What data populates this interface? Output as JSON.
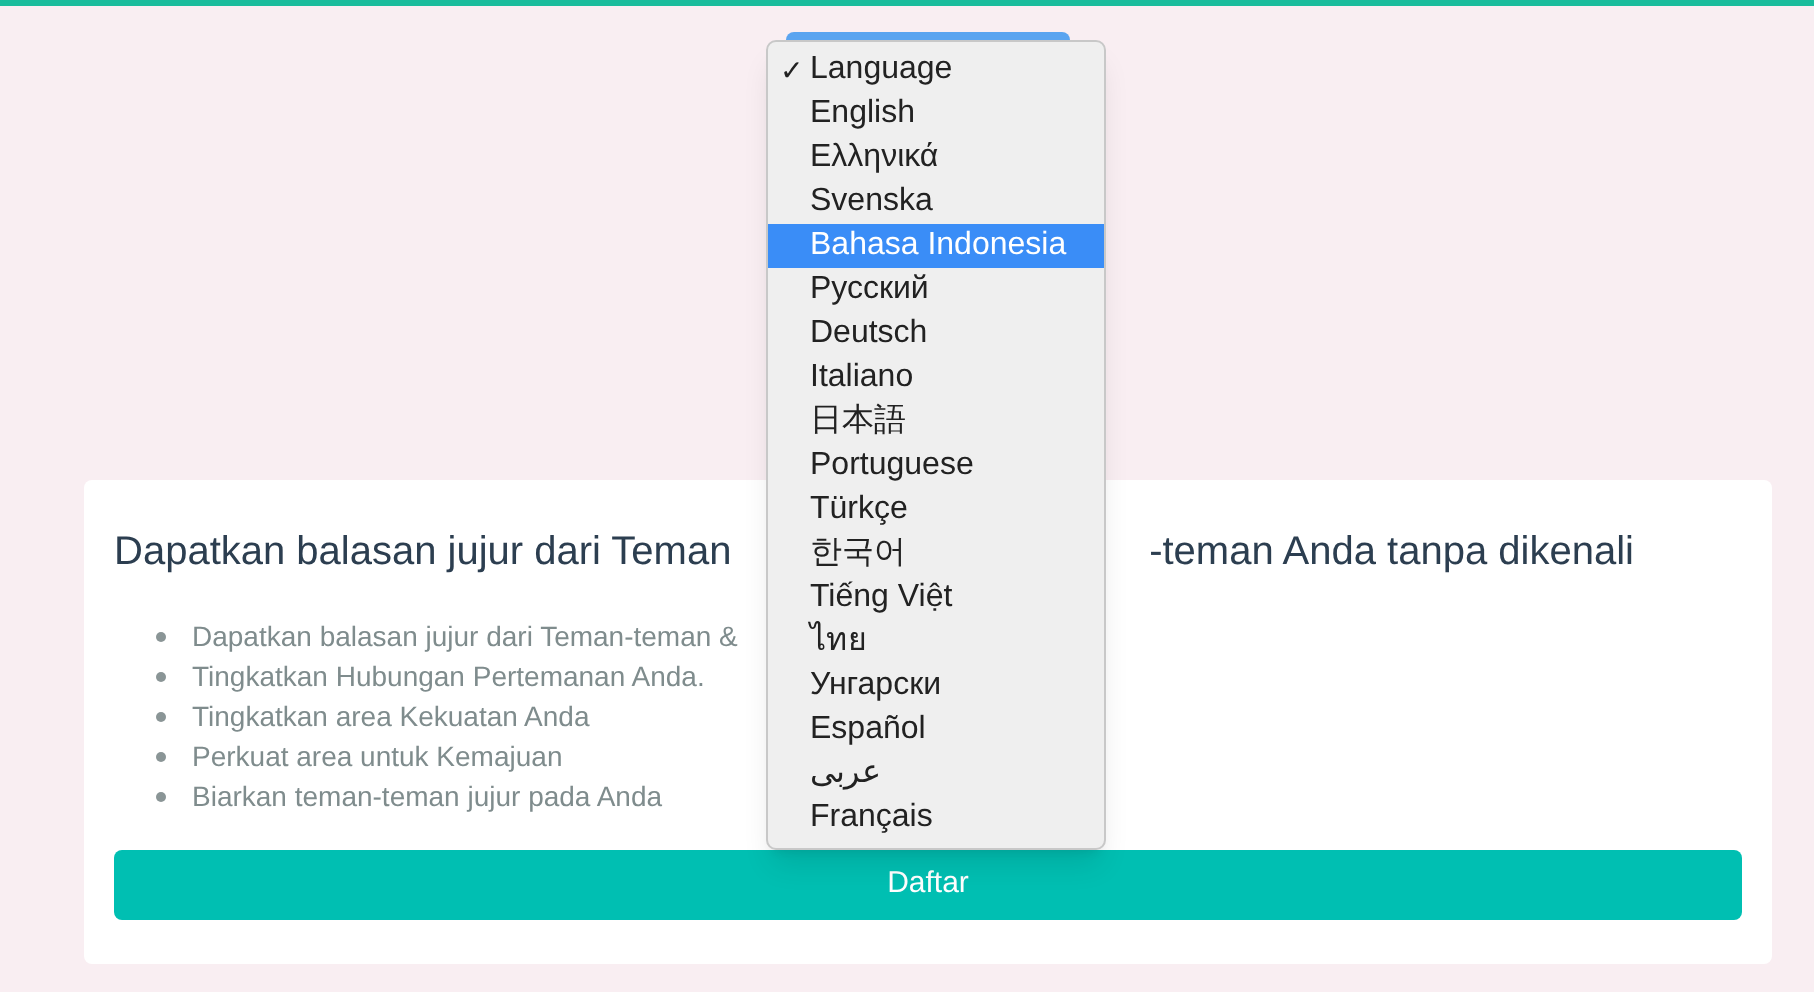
{
  "language_menu": {
    "items": [
      {
        "label": "Language",
        "checked": true,
        "highlighted": false
      },
      {
        "label": "English",
        "checked": false,
        "highlighted": false
      },
      {
        "label": "Ελληνικά",
        "checked": false,
        "highlighted": false
      },
      {
        "label": "Svenska",
        "checked": false,
        "highlighted": false
      },
      {
        "label": "Bahasa Indonesia",
        "checked": false,
        "highlighted": true
      },
      {
        "label": "Русский",
        "checked": false,
        "highlighted": false
      },
      {
        "label": "Deutsch",
        "checked": false,
        "highlighted": false
      },
      {
        "label": "Italiano",
        "checked": false,
        "highlighted": false
      },
      {
        "label": "日本語",
        "checked": false,
        "highlighted": false
      },
      {
        "label": "Portuguese",
        "checked": false,
        "highlighted": false
      },
      {
        "label": "Türkçe",
        "checked": false,
        "highlighted": false
      },
      {
        "label": "한국어",
        "checked": false,
        "highlighted": false
      },
      {
        "label": "Tiếng Việt",
        "checked": false,
        "highlighted": false
      },
      {
        "label": "ไทย",
        "checked": false,
        "highlighted": false
      },
      {
        "label": "Унгарски",
        "checked": false,
        "highlighted": false
      },
      {
        "label": "Español",
        "checked": false,
        "highlighted": false
      },
      {
        "label": "عربى",
        "checked": false,
        "highlighted": false
      },
      {
        "label": "Français",
        "checked": false,
        "highlighted": false
      }
    ],
    "check_mark": "✓"
  },
  "card": {
    "heading_left": "Dapatkan balasan jujur dari Teman",
    "heading_right": "-teman Anda tanpa dikenali",
    "bullets": [
      "Dapatkan balasan jujur dari Teman-teman &",
      "Tingkatkan Hubungan Pertemanan Anda.",
      "Tingkatkan area Kekuatan Anda",
      "Perkuat area untuk Kemajuan",
      "Biarkan teman-teman jujur pada Anda"
    ],
    "button": "Daftar"
  }
}
